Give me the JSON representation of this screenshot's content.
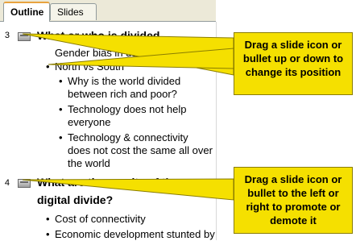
{
  "tabs": [
    {
      "label": "Outline",
      "active": true
    },
    {
      "label": "Slides",
      "active": false
    }
  ],
  "slides": [
    {
      "number": "3",
      "title": "What or who is divided",
      "bullets": [
        "Gender bias in use of technology",
        "North vs South"
      ],
      "subbullets": [
        "Why is the world divided between rich and poor?",
        "Technology does not help everyone",
        "Technology & connectivity does not cost the same all over the world"
      ]
    },
    {
      "number": "4",
      "title": "What are the results of the digital divide?",
      "bullets": [
        "Cost of connectivity",
        "Economic development stunted by"
      ]
    }
  ],
  "callouts": [
    {
      "text": "Drag a slide icon or bullet up or down to change its position"
    },
    {
      "text": "Drag a slide icon or bullet to the left or right to promote or demote it"
    }
  ],
  "colors": {
    "callout_fill": "#f5e000",
    "tab_accent": "#e8a33f"
  }
}
